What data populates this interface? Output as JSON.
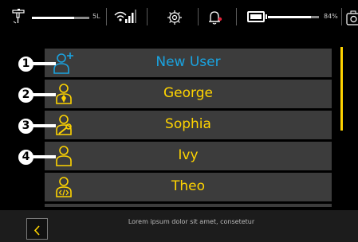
{
  "status_bar": {
    "level_label": "5L",
    "level_percent": 74,
    "battery_label": "84%",
    "battery_percent": 84,
    "icons": [
      "spray-gun-icon",
      "wifi-icon",
      "signal-icon",
      "settings-icon",
      "notification-bell-icon",
      "battery-icon",
      "screenshot-camera-icon"
    ]
  },
  "users": [
    {
      "name": "New User",
      "icon": "add-user-icon",
      "color": "#1aa3e0",
      "callout": "1"
    },
    {
      "name": "George",
      "icon": "user-suit-icon",
      "color": "#ffd400",
      "callout": "2"
    },
    {
      "name": "Sophia",
      "icon": "user-wrench-icon",
      "color": "#ffd400",
      "callout": "3"
    },
    {
      "name": "Ivy",
      "icon": "user-icon",
      "color": "#ffd400",
      "callout": "4"
    },
    {
      "name": "Theo",
      "icon": "user-code-icon",
      "color": "#ffd400",
      "callout": ""
    }
  ],
  "footer": {
    "text": "Lorem ipsum dolor sit amet, consetetur"
  },
  "colors": {
    "accent": "#ffd400",
    "new_user": "#1aa3e0",
    "row_bg": "#3c3c3c",
    "background": "#000000"
  }
}
